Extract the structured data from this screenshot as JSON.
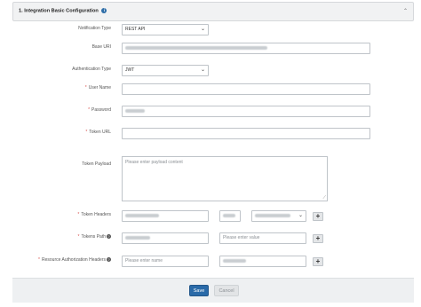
{
  "section": {
    "title": "1. Integration Basic Configuration",
    "info_icon": "info-icon",
    "collapse_icon": "chevron-up-icon"
  },
  "fields": {
    "notification_type": {
      "label": "Notification Type",
      "value": "REST API"
    },
    "base_uri": {
      "label": "Base URI"
    },
    "authentication_type": {
      "label": "Authentication Type",
      "value": "JWT"
    },
    "user_name": {
      "label": "User Name"
    },
    "password": {
      "label": "Password"
    },
    "token_url": {
      "label": "Token URL"
    },
    "token_payload": {
      "label": "Token Payload",
      "placeholder": "Please enter payload content"
    },
    "token_headers": {
      "label": "Token Headers"
    },
    "tokens_path": {
      "label": "Tokens Path",
      "value_placeholder": "Please enter value"
    },
    "resource_auth_headers": {
      "label": "Resource Authorization Headers",
      "name_placeholder": "Please enter name"
    }
  },
  "buttons": {
    "save": "Save",
    "cancel": "Cancel",
    "add": "+"
  },
  "required_mark": "*",
  "colors": {
    "primary": "#2a6aa8",
    "required": "#d9534f",
    "header_bg": "#f1f2f3"
  }
}
